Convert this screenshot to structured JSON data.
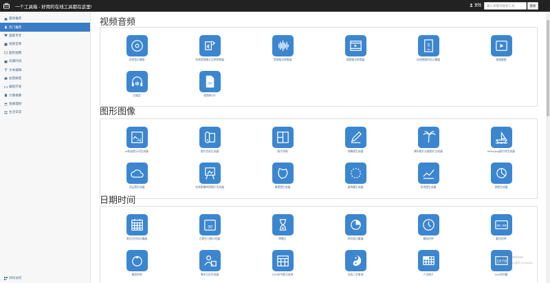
{
  "header": {
    "brand": "一个工具箱 - 好用的在线工具都在这里!",
    "user": "登陆",
    "search_placeholder": "输入关键词搜索工具",
    "search_button": "搜索"
  },
  "sidebar": {
    "items": [
      {
        "label": "最新推荐",
        "icon": "home-icon"
      },
      {
        "label": "热门推荐",
        "icon": "flame-icon",
        "active": true
      },
      {
        "label": "国家专享",
        "icon": "heart-icon"
      },
      {
        "label": "视频音频",
        "icon": "film-icon"
      },
      {
        "label": "图形图像",
        "icon": "image-icon"
      },
      {
        "label": "日期时间",
        "icon": "calendar-icon"
      },
      {
        "label": "文本编辑",
        "icon": "text-icon"
      },
      {
        "label": "加密解密",
        "icon": "lock-icon"
      },
      {
        "label": "编程开发",
        "icon": "code-icon"
      },
      {
        "label": "计算换算",
        "icon": "calculator-icon"
      },
      {
        "label": "金融理财",
        "icon": "bank-icon"
      },
      {
        "label": "生活日常",
        "icon": "grid-icon"
      }
    ],
    "footer": "扫码访问"
  },
  "sections": [
    {
      "title": "视频音频",
      "tools": [
        {
          "label": "在线音乐播放",
          "icon": "disc-icon"
        },
        {
          "label": "在线音频格式互转转换器",
          "icon": "audio-convert-icon"
        },
        {
          "label": "音频格式转换器",
          "icon": "waveform-icon"
        },
        {
          "label": "视频格式转换器",
          "icon": "video-icon"
        },
        {
          "label": "在线视频时长计算器",
          "icon": "five-min-icon"
        },
        {
          "label": "视频截图",
          "icon": "video-frame-icon"
        },
        {
          "label": "白噪音",
          "icon": "headphones-icon"
        },
        {
          "label": "视频转GIF",
          "icon": "gif-file-icon"
        }
      ]
    },
    {
      "title": "图形图像",
      "tools": [
        {
          "label": "AI绘画提示词生成器",
          "icon": "ai-image-icon"
        },
        {
          "label": "图片色彩生成器",
          "icon": "palette-icon"
        },
        {
          "label": "图片拼接",
          "icon": "collage-icon"
        },
        {
          "label": "线稿图生成器",
          "icon": "pencil-icon"
        },
        {
          "label": "横向图片无缝图片生成器",
          "icon": "palm-icon"
        },
        {
          "label": "Webp/png图片转生成器",
          "icon": "boat-icon"
        },
        {
          "label": "词云图生成器",
          "icon": "cloud-icon"
        },
        {
          "label": "在线图像转换图片生成器",
          "icon": "easel-icon"
        },
        {
          "label": "像素图生成器",
          "icon": "map-icon"
        },
        {
          "label": "虚线圆生成器",
          "icon": "dashed-circle-icon"
        },
        {
          "label": "折线图生成器",
          "icon": "line-chart-icon"
        },
        {
          "label": "饼图生成器",
          "icon": "pie-chart-icon"
        }
      ]
    },
    {
      "title": "日期时间",
      "tools": [
        {
          "label": "周日历时间计算器",
          "icon": "calendar-grid-icon"
        },
        {
          "label": "日期生日倒计时器",
          "icon": "day-30-icon"
        },
        {
          "label": "倒数日",
          "icon": "hourglass-icon"
        },
        {
          "label": "时间差计算器",
          "icon": "pie-clock-icon"
        },
        {
          "label": "模拟时钟",
          "icon": "clock-icon"
        },
        {
          "label": "翻页时钟",
          "icon": "digital-clock-icon"
        },
        {
          "label": "番茄时钟",
          "icon": "tomato-icon"
        },
        {
          "label": "每年日历生成器",
          "icon": "person-calendar-icon"
        },
        {
          "label": "2024年节假日安排",
          "icon": "calendar-year-icon"
        },
        {
          "label": "生辰八字查询",
          "icon": "yin-yang-icon"
        },
        {
          "label": "人生格子",
          "icon": "life-grid-icon"
        },
        {
          "label": "Unix时间戳",
          "icon": "timestamp-1970-icon"
        }
      ]
    }
  ],
  "watermark": {
    "line1": "激活 Windows",
    "line2": "转到\"设置\"以激活 Windows。"
  }
}
